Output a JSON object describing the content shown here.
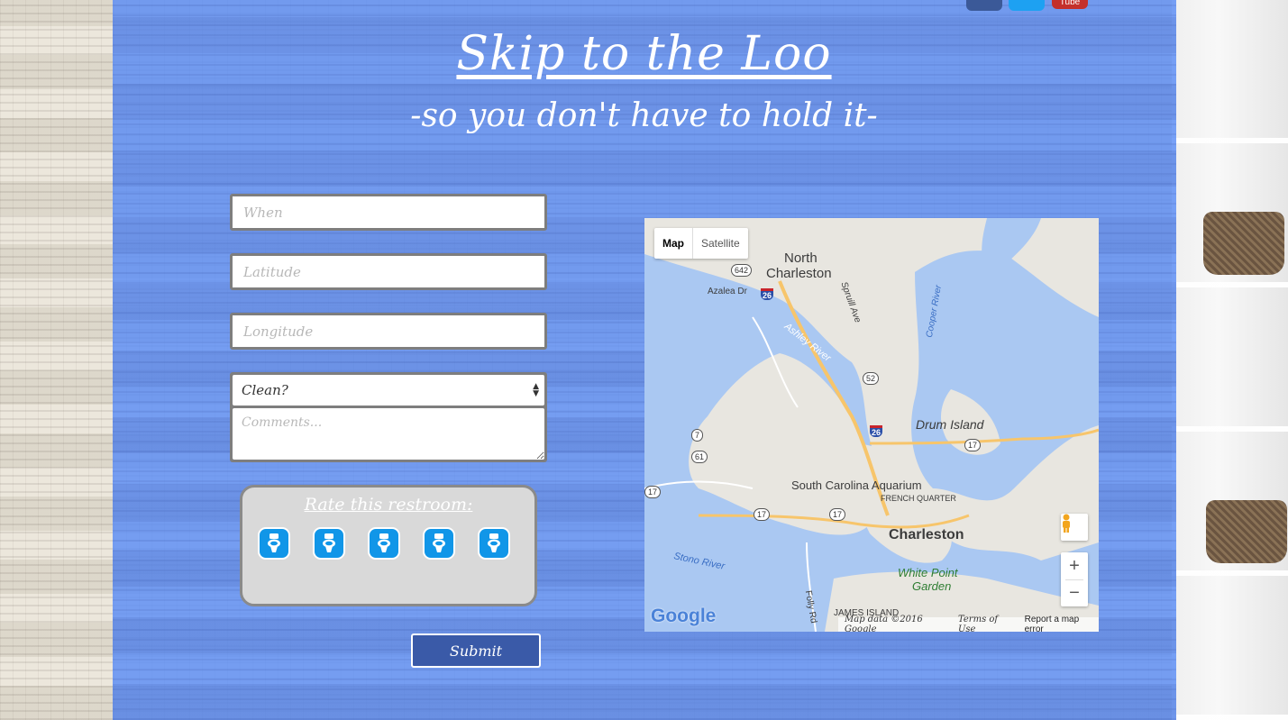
{
  "header": {
    "title": "Skip to the Loo",
    "subtitle": "-so you don't have to hold it-"
  },
  "social": {
    "icons": [
      "facebook-icon",
      "twitter-icon",
      "youtube-icon"
    ],
    "youtube_label": "Tube"
  },
  "form": {
    "when_placeholder": "When",
    "latitude_placeholder": "Latitude",
    "longitude_placeholder": "Longitude",
    "clean_selected": "Clean?",
    "comments_placeholder": "Comments...",
    "rate_title": "Rate this restroom:",
    "rating_icons": 5,
    "submit_label": "Submit"
  },
  "map": {
    "map_type_active": "Map",
    "map_type_other": "Satellite",
    "labels": {
      "north_charleston": "North\nCharleston",
      "north": "North",
      "charleston_n": "Charleston",
      "azalea": "Azalea Dr",
      "spruill": "Spruill Ave",
      "cooper": "Cooper River",
      "ashley": "Ashley River",
      "drum": "Drum Island",
      "aquarium": "South Carolina Aquarium",
      "french": "FRENCH QUARTER",
      "charleston": "Charleston",
      "stono": "Stono River",
      "white_point": "White Point",
      "garden": "Garden",
      "folly": "Folly Rd",
      "james": "JAMES ISLAND"
    },
    "shields": {
      "r642": "642",
      "i26a": "26",
      "r52": "52",
      "i26b": "26",
      "r17a": "17",
      "r7": "7",
      "r61": "61",
      "r17b": "17",
      "r17c": "17",
      "r17d": "17"
    },
    "zoom_in": "+",
    "zoom_out": "−",
    "google": "Google",
    "map_data": "Map data ©2016 Google",
    "terms": "Terms of Use",
    "report": "Report a map error"
  },
  "colors": {
    "overlay": "#5a8cf5",
    "toilet_icon": "#1196e8",
    "submit": "#3a5aa8"
  }
}
